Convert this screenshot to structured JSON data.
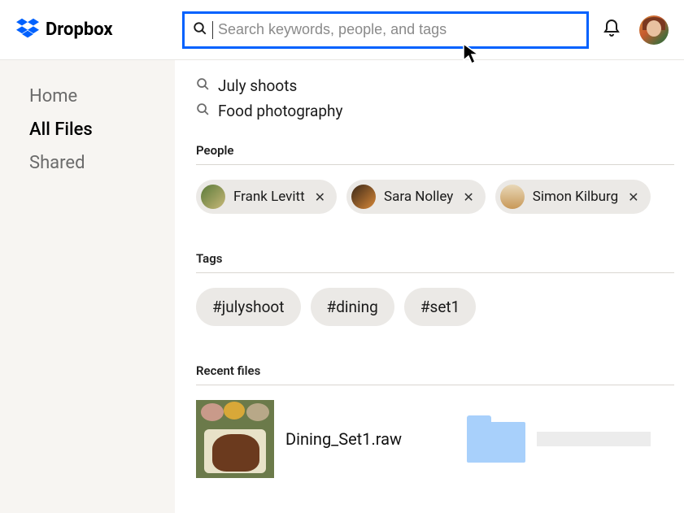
{
  "brand": "Dropbox",
  "search": {
    "placeholder": "Search keywords, people, and tags"
  },
  "sidebar": {
    "items": [
      {
        "label": "Home",
        "active": false
      },
      {
        "label": "All Files",
        "active": true
      },
      {
        "label": "Shared",
        "active": false
      }
    ]
  },
  "suggestions": [
    {
      "label": "July shoots"
    },
    {
      "label": "Food photography"
    }
  ],
  "sections": {
    "people": "People",
    "tags": "Tags",
    "recent": "Recent files"
  },
  "people": [
    {
      "name": "Frank Levitt",
      "avatar_bg": "linear-gradient(135deg,#5a7a3a,#c8b878)"
    },
    {
      "name": "Sara Nolley",
      "avatar_bg": "linear-gradient(135deg,#3a2818,#d88838)"
    },
    {
      "name": "Simon Kilburg",
      "avatar_bg": "linear-gradient(180deg,#e8d8b8,#c89858)"
    }
  ],
  "tags": [
    {
      "label": "#julyshoot"
    },
    {
      "label": "#dining"
    },
    {
      "label": "#set1"
    }
  ],
  "recent_files": [
    {
      "name": "Dining_Set1.raw",
      "kind": "image"
    },
    {
      "name": "",
      "kind": "folder"
    }
  ]
}
